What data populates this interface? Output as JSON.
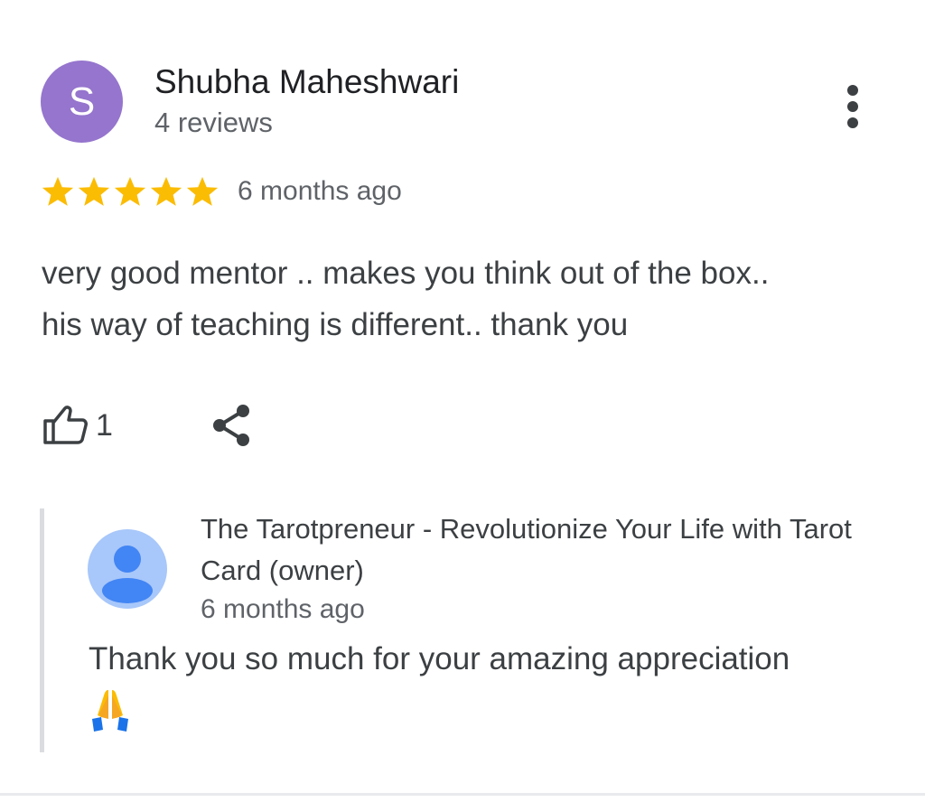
{
  "review": {
    "reviewer": {
      "initial": "S",
      "name": "Shubha Maheshwari",
      "review_count": "4 reviews",
      "avatar_color": "#9575cd"
    },
    "rating": 5,
    "max_rating": 5,
    "star_color": "#fbbc04",
    "time": "6 months ago",
    "text": "very good mentor .. makes you think out of the box..\nhis way of teaching is different.. thank you",
    "likes": "1",
    "more_icon": "more-vertical-icon",
    "like_icon": "thumbs-up-icon",
    "share_icon": "share-icon"
  },
  "owner_reply": {
    "name": "The Tarotpreneur - Revolutionize Your Life with Tarot Card (owner)",
    "time": "6 months ago",
    "text": "Thank you so much for your amazing appreciation",
    "emoji": "folded-hands-emoji",
    "avatar_icon": "person-icon",
    "avatar_bg_color": "#a8c7fa",
    "avatar_fg_color": "#4285f4"
  }
}
